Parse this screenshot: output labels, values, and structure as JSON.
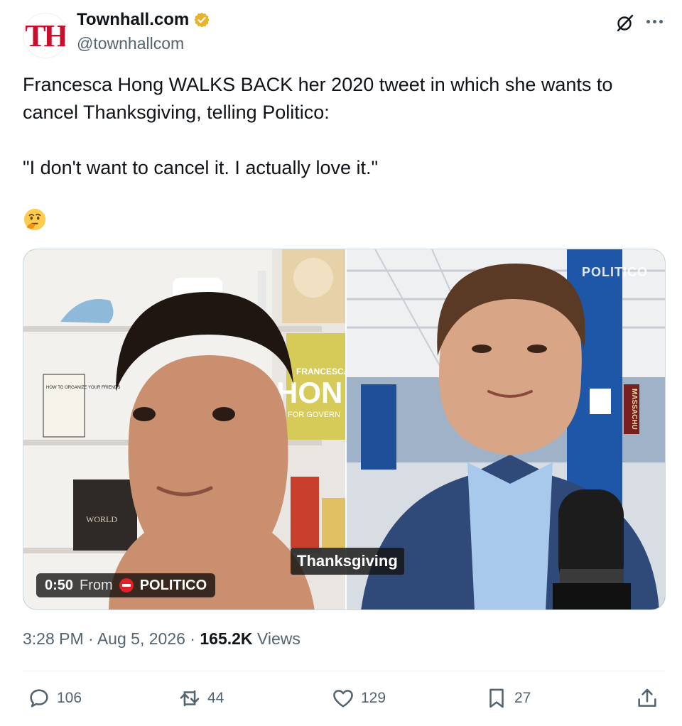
{
  "author": {
    "avatar_text": "TH",
    "display_name": "Townhall.com",
    "handle": "@townhallcom",
    "verified_icon": "gold-verified-badge"
  },
  "tweet": {
    "lines": [
      "Francesca Hong WALKS BACK her 2020 tweet in which she wants to",
      "cancel Thanksgiving, telling Politico:",
      "",
      "\"I don't want to cancel it. I actually love it.\""
    ],
    "emoji": "🤔"
  },
  "media": {
    "caption": "Thanksgiving",
    "watermark": "POLITICO",
    "duration": "0:50",
    "from_label": "From",
    "source": "POLITICO",
    "left_scene": {
      "poster_text_1": "FRANCESCA",
      "poster_text_2": "HON",
      "poster_text_3": "FOR GOVERN",
      "book_text": "HOW TO ORGANIZE YOUR FRIENDS",
      "shelf_book": "WORLD"
    },
    "right_scene": {
      "banner": "MASSACHU"
    }
  },
  "meta": {
    "time": "3:28 PM",
    "dot": "·",
    "date": "Aug 5, 2026",
    "views_count": "165.2K",
    "views_label": "Views"
  },
  "actions": {
    "replies": "106",
    "reposts": "44",
    "likes": "129",
    "bookmarks": "27"
  },
  "icons": [
    "grok-icon",
    "more-icon",
    "reply-icon",
    "repost-icon",
    "like-icon",
    "bookmark-icon",
    "share-icon"
  ],
  "colors": {
    "text": "#0f1419",
    "secondary": "#536471",
    "brand_red": "#c8102e",
    "verified_gold": "#e8b32a"
  }
}
